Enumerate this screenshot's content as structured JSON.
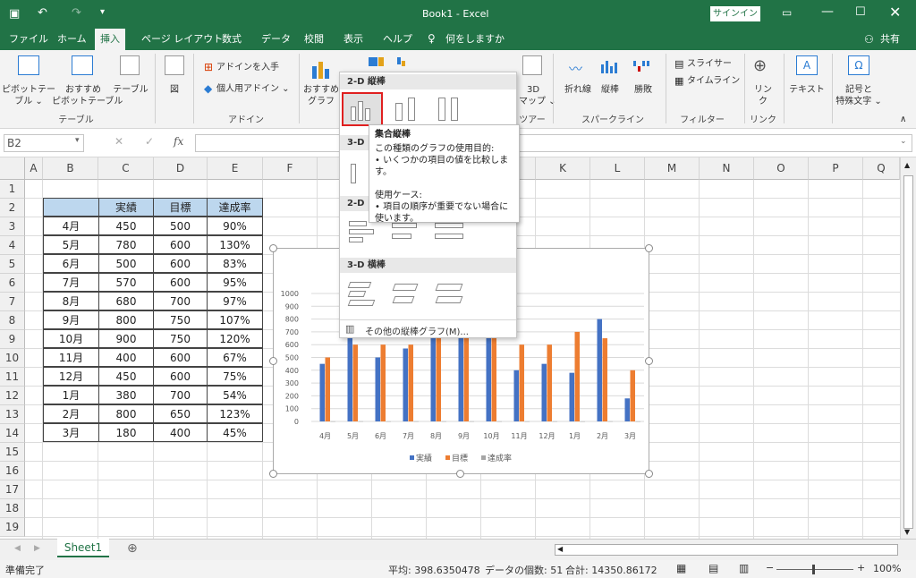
{
  "title": {
    "doc": "Book1 - Excel",
    "signin": "サインイン"
  },
  "menu": [
    "ファイル",
    "ホーム",
    "挿入",
    "ページ レイアウト",
    "数式",
    "データ",
    "校閲",
    "表示",
    "ヘルプ",
    "何をしますか",
    "共有"
  ],
  "ribbon": {
    "pivot": "ピボットテー\nブル ⌄",
    "recpivot": "おすすめ\nピボットテーブル",
    "table": "テーブル",
    "fig": "図",
    "grp_table": "テーブル",
    "getaddin": "アドインを入手",
    "myaddin": "個人用アドイン ⌄",
    "grp_addin": "アドイン",
    "reccharts": "おすすめ\nグラフ",
    "map3d": "3D\nマップ ⌄",
    "grp_tour": "ツアー",
    "line": "折れ線",
    "column": "縦棒",
    "winloss": "勝敗",
    "grp_spark": "スパークライン",
    "slicer": "スライサー",
    "timeline": "タイムライン",
    "grp_filter": "フィルター",
    "link": "リン\nク",
    "grp_link": "リンク",
    "text": "テキスト",
    "symbol": "記号と\n特殊文字 ⌄"
  },
  "formula": {
    "namebox": "B2",
    "fx": "fx"
  },
  "columns": [
    "A",
    "B",
    "C",
    "D",
    "E",
    "F",
    "G",
    "H",
    "I",
    "J",
    "K",
    "L",
    "M",
    "N",
    "O",
    "P",
    "Q"
  ],
  "rows": [
    "1",
    "2",
    "3",
    "4",
    "5",
    "6",
    "7",
    "8",
    "9",
    "10",
    "11",
    "12",
    "13",
    "14",
    "15",
    "16",
    "17",
    "18",
    "19"
  ],
  "table": {
    "headers": [
      "",
      "実績",
      "目標",
      "達成率"
    ],
    "rows": [
      [
        "4月",
        "450",
        "500",
        "90%"
      ],
      [
        "5月",
        "780",
        "600",
        "130%"
      ],
      [
        "6月",
        "500",
        "600",
        "83%"
      ],
      [
        "7月",
        "570",
        "600",
        "95%"
      ],
      [
        "8月",
        "680",
        "700",
        "97%"
      ],
      [
        "9月",
        "800",
        "750",
        "107%"
      ],
      [
        "10月",
        "900",
        "750",
        "120%"
      ],
      [
        "11月",
        "400",
        "600",
        "67%"
      ],
      [
        "12月",
        "450",
        "600",
        "75%"
      ],
      [
        "1月",
        "380",
        "700",
        "54%"
      ],
      [
        "2月",
        "800",
        "650",
        "123%"
      ],
      [
        "3月",
        "180",
        "400",
        "45%"
      ]
    ]
  },
  "dropdown": {
    "h2d": "2-D 縦棒",
    "h3d": "3-D",
    "h2dbar": "2-D",
    "h3dbar": "3-D 横棒",
    "more": "その他の縦棒グラフ(M)..."
  },
  "tooltip": {
    "title": "集合縦棒",
    "l1": "この種類のグラフの使用目的:",
    "l2": "• いくつかの項目の値を比較します。",
    "l3": "使用ケース:",
    "l4": "• 項目の順序が重要でない場合に",
    "l5": "使います。"
  },
  "chart_data": {
    "type": "bar",
    "categories": [
      "4月",
      "5月",
      "6月",
      "7月",
      "8月",
      "9月",
      "10月",
      "11月",
      "12月",
      "1月",
      "2月",
      "3月"
    ],
    "series": [
      {
        "name": "実績",
        "color": "#4472c4",
        "values": [
          450,
          780,
          500,
          570,
          680,
          800,
          900,
          400,
          450,
          380,
          800,
          180
        ]
      },
      {
        "name": "目標",
        "color": "#ed7d31",
        "values": [
          500,
          600,
          600,
          600,
          700,
          750,
          750,
          600,
          600,
          700,
          650,
          400
        ]
      },
      {
        "name": "達成率",
        "color": "#a5a5a5",
        "values": [
          0.9,
          1.3,
          0.83,
          0.95,
          0.97,
          1.07,
          1.2,
          0.67,
          0.75,
          0.54,
          1.23,
          0.45
        ]
      }
    ],
    "ylim": [
      0,
      1000
    ],
    "yticks": [
      "0",
      "100",
      "200",
      "300",
      "400",
      "500",
      "600",
      "700",
      "800",
      "900",
      "1000"
    ],
    "grid": true,
    "legend": "bottom"
  },
  "sheet": {
    "tab": "Sheet1"
  },
  "status": {
    "ready": "準備完了",
    "avg": "平均: 398.6350478",
    "count": "データの個数: 51",
    "sum": "合計: 14350.86172",
    "zoom": "100%"
  }
}
